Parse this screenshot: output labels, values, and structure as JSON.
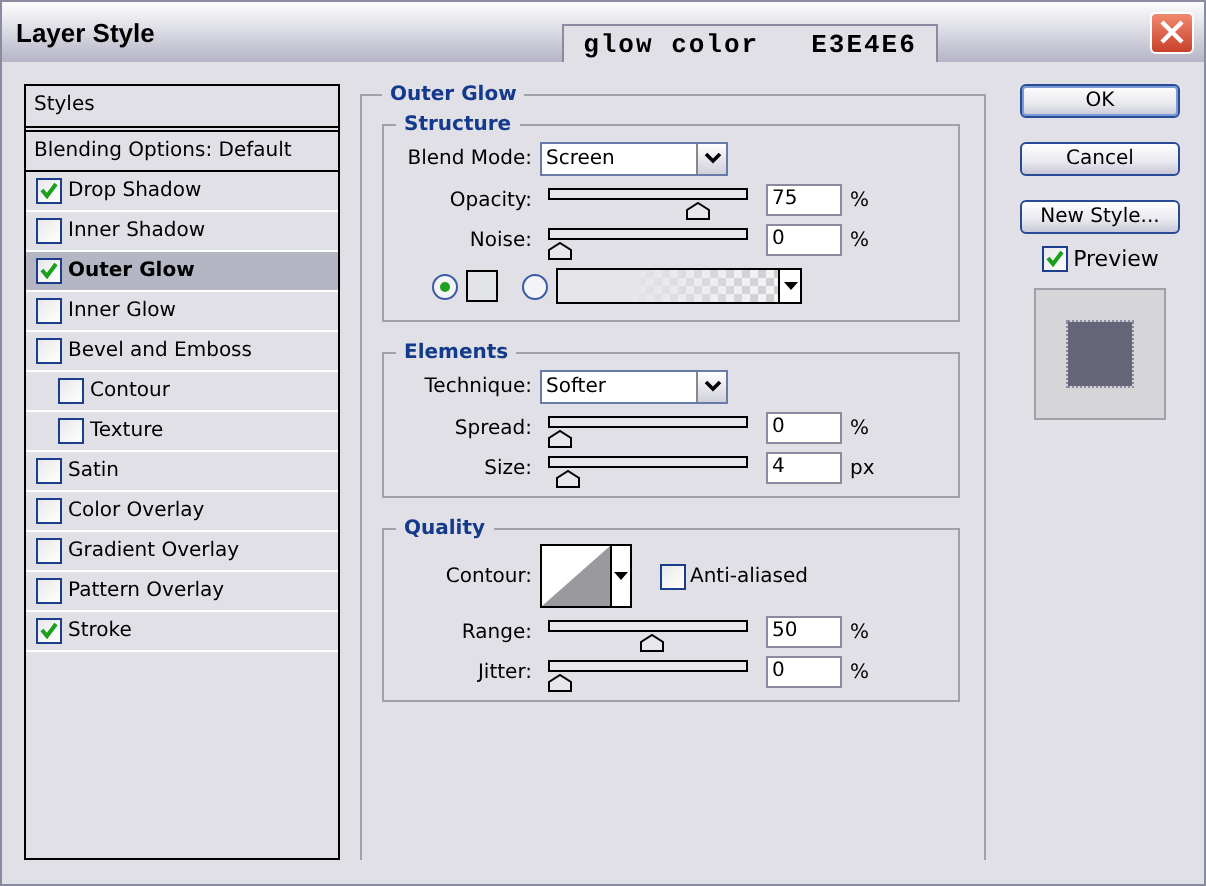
{
  "window": {
    "title": "Layer Style"
  },
  "overlay_tab": {
    "label": "glow color",
    "value": "E3E4E6"
  },
  "styles_list": {
    "header": "Styles",
    "items": [
      {
        "label": "Blending Options: Default",
        "kind": "plain",
        "selected": false
      },
      {
        "label": "Drop Shadow",
        "kind": "check",
        "checked": true,
        "selected": false
      },
      {
        "label": "Inner Shadow",
        "kind": "check",
        "checked": false,
        "selected": false
      },
      {
        "label": "Outer Glow",
        "kind": "check",
        "checked": true,
        "selected": true
      },
      {
        "label": "Inner Glow",
        "kind": "check",
        "checked": false,
        "selected": false
      },
      {
        "label": "Bevel and Emboss",
        "kind": "check",
        "checked": false,
        "selected": false,
        "children": [
          {
            "label": "Contour",
            "kind": "check",
            "checked": false,
            "selected": false
          },
          {
            "label": "Texture",
            "kind": "check",
            "checked": false,
            "selected": false
          }
        ]
      },
      {
        "label": "Satin",
        "kind": "check",
        "checked": false,
        "selected": false
      },
      {
        "label": "Color Overlay",
        "kind": "check",
        "checked": false,
        "selected": false
      },
      {
        "label": "Gradient Overlay",
        "kind": "check",
        "checked": false,
        "selected": false
      },
      {
        "label": "Pattern Overlay",
        "kind": "check",
        "checked": false,
        "selected": false
      },
      {
        "label": "Stroke",
        "kind": "check",
        "checked": true,
        "selected": false
      }
    ]
  },
  "outer_glow": {
    "title": "Outer Glow",
    "groups": [
      {
        "title": "Structure",
        "rows": [
          {
            "kind": "dropdown",
            "label": "Blend Mode:",
            "value": "Screen"
          },
          {
            "kind": "slider",
            "label": "Opacity:",
            "level": 0.75,
            "value": "75",
            "unit": "%"
          },
          {
            "kind": "slider",
            "label": "Noise:",
            "level": 0,
            "value": "0",
            "unit": "%"
          },
          {
            "kind": "source",
            "options": [
              {
                "kind": "color",
                "selected": true
              },
              {
                "kind": "gradient",
                "selected": false
              }
            ]
          }
        ]
      },
      {
        "title": "Elements",
        "rows": [
          {
            "kind": "dropdown",
            "label": "Technique:",
            "value": "Softer"
          },
          {
            "kind": "slider",
            "label": "Spread:",
            "level": 0,
            "value": "0",
            "unit": "%"
          },
          {
            "kind": "slider",
            "label": "Size:",
            "level": 0.04,
            "value": "4",
            "unit": "px"
          }
        ]
      },
      {
        "title": "Quality",
        "rows": [
          {
            "kind": "contour",
            "label": "Contour:",
            "option": {
              "label": "Anti-aliased",
              "checked": false
            }
          },
          {
            "kind": "slider",
            "label": "Range:",
            "level": 0.5,
            "value": "50",
            "unit": "%"
          },
          {
            "kind": "slider",
            "label": "Jitter:",
            "level": 0,
            "value": "0",
            "unit": "%"
          }
        ]
      }
    ]
  },
  "buttons": [
    {
      "label": "OK",
      "default": true
    },
    {
      "label": "Cancel",
      "default": false
    },
    {
      "label": "New Style...",
      "default": false
    }
  ],
  "preview": {
    "label": "Preview",
    "checked": true
  }
}
